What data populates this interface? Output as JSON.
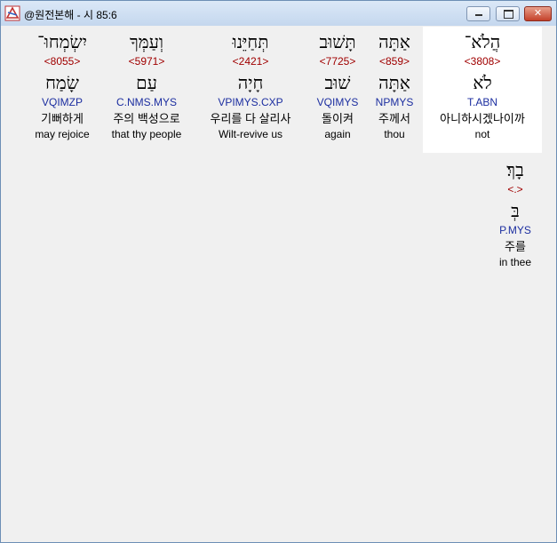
{
  "window": {
    "title": "@원전본해 - 시 85:6",
    "icon": "bible-app-icon",
    "controls": [
      "minimize",
      "maximize",
      "close"
    ]
  },
  "words": [
    {
      "hebrew": "הֲלֹא־",
      "strong": "<3808>",
      "lemma": "לֹא",
      "morph": "T.ABN",
      "korean": "아니하시겠나이까",
      "english": "not",
      "highlighted": true
    },
    {
      "hebrew": "אַתָּה",
      "strong": "<859>",
      "lemma": "אַתָּה",
      "morph": "NPMYS",
      "korean": "주께서",
      "english": "thou",
      "highlighted": false
    },
    {
      "hebrew": "תָּשׁוּב",
      "strong": "<7725>",
      "lemma": "שׁוּב",
      "morph": "VQIMYS",
      "korean": "돌이켜",
      "english": "again",
      "highlighted": false
    },
    {
      "hebrew": "תְּחַיֵּנוּ",
      "strong": "<2421>",
      "lemma": "חָיָה",
      "morph": "VPIMYS.CXP",
      "korean": "우리를 다 살리사",
      "english": "Wilt-revive us",
      "highlighted": false
    },
    {
      "hebrew": "וְעַמְּךָ",
      "strong": "<5971>",
      "lemma": "עַם",
      "morph": "C.NMS.MYS",
      "korean": "주의 백성으로",
      "english": "that thy people",
      "highlighted": false
    },
    {
      "hebrew": "יִשְׂמְחוּ־",
      "strong": "<8055>",
      "lemma": "שָׂמַח",
      "morph": "VQIMZP",
      "korean": "기뻐하게",
      "english": "may rejoice",
      "highlighted": false
    },
    {
      "hebrew": "בָךְ׃",
      "strong": "<.>",
      "lemma": "בְּ",
      "morph": "P.MYS",
      "korean": "주를",
      "english": "in thee",
      "highlighted": false
    }
  ]
}
